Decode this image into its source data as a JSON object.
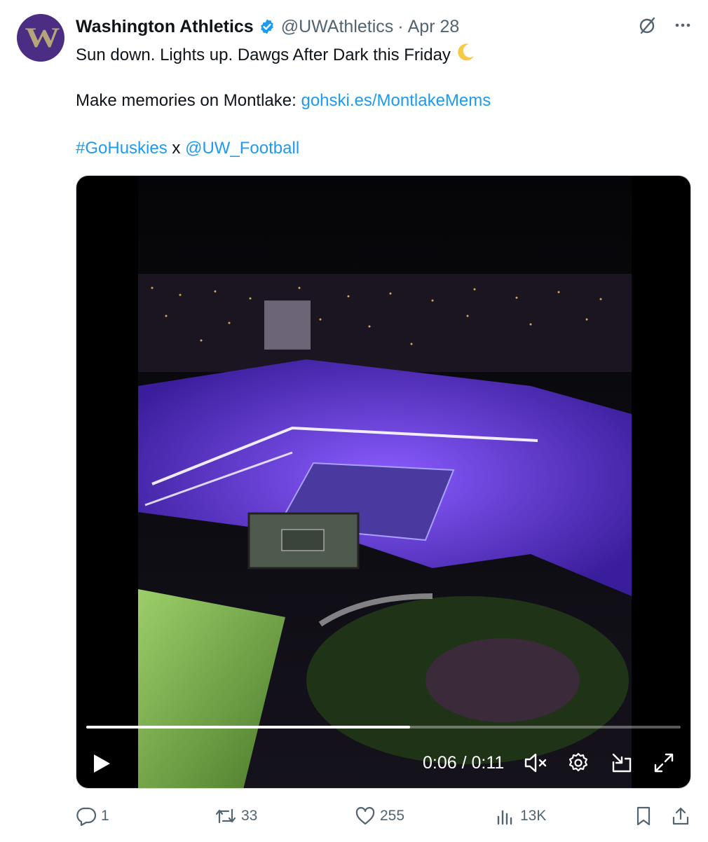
{
  "account": {
    "avatar_letter": "W",
    "name": "Washington Athletics",
    "handle": "@UWAthletics",
    "separator": "·",
    "date": "Apr 28"
  },
  "tweet": {
    "line1": "Sun down. Lights up. Dawgs After Dark this Friday",
    "line2_prefix": "Make memories on Montlake: ",
    "line2_link": "gohski.es/MontlakeMems",
    "hashtag": "#GoHuskies",
    "joiner": " x ",
    "mention": "@UW_Football"
  },
  "video": {
    "time_display": "0:06 / 0:11",
    "progress_fraction": 0.545,
    "muted": true
  },
  "actions": {
    "replies": "1",
    "reposts": "33",
    "likes": "255",
    "views": "13K"
  },
  "colors": {
    "link": "#1d9bf0",
    "verified": "#1d9bf0",
    "muted_text": "#536471",
    "avatar_bg": "#4b2e83",
    "avatar_letter": "#b7a57a",
    "stadium_purple": "#6a3df0"
  },
  "icons": {
    "verified": "verified-badge-icon",
    "grok": "grok-icon",
    "more": "more-icon",
    "moon": "crescent-moon-emoji",
    "play": "play-icon",
    "mute": "volume-muted-icon",
    "settings": "settings-gear-icon",
    "dock": "dock-icon",
    "fullscreen": "fullscreen-icon",
    "reply": "reply-icon",
    "repost": "repost-icon",
    "like": "heart-icon",
    "views": "views-chart-icon",
    "bookmark": "bookmark-icon",
    "share": "share-icon"
  }
}
